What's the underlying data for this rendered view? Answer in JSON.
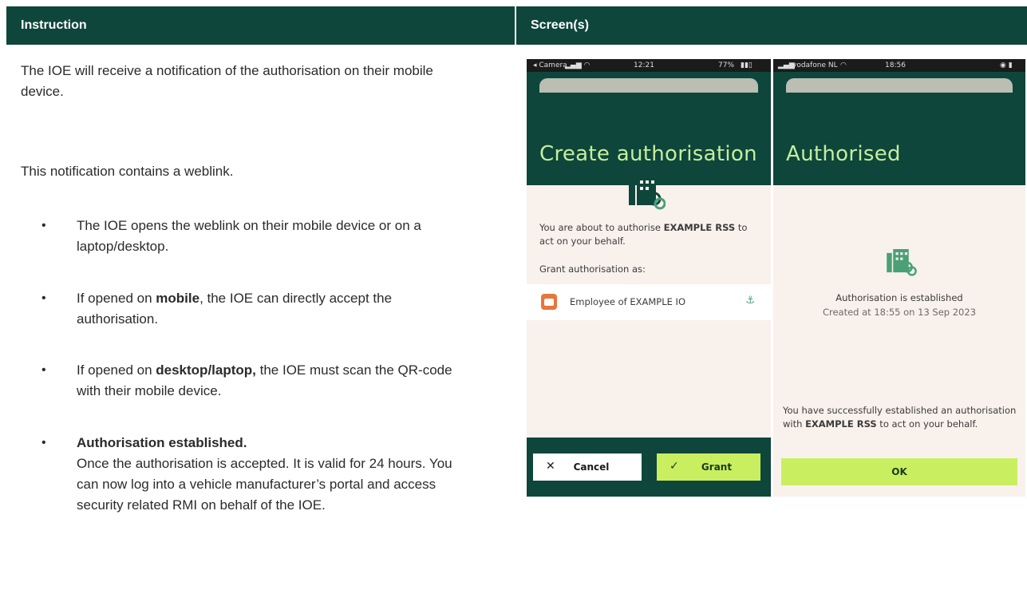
{
  "header": {
    "left": "Instruction",
    "right": "Screen(s)"
  },
  "instructions": {
    "p1": "The IOE will receive a notification of the authorisation on their mobile device.",
    "p2": "This notification contains a weblink.",
    "bullets": [
      {
        "pre": "The IOE opens the weblink on their mobile device or on a laptop/desktop.",
        "bold": "",
        "post": ""
      },
      {
        "pre": "If opened on ",
        "bold": "mobile",
        "post": ", the IOE can directly accept the authorisation."
      },
      {
        "pre": "If opened on ",
        "bold": "desktop/laptop,",
        "post": " the IOE must scan the QR-code with their mobile device."
      },
      {
        "pre": "",
        "bold": "Authorisation established.",
        "post": "Once the authorisation is accepted. It is valid for 24 hours. You can now log into a vehicle manufacturer’s portal and access security related RMI on behalf of the IOE."
      }
    ]
  },
  "phone1": {
    "status": {
      "carrier": "◂ Camera",
      "time": "12:21",
      "battery": "77%"
    },
    "title": "Create authorisation",
    "about_pre": "You are about to authorise ",
    "about_bold": "EXAMPLE RSS",
    "about_post": " to act on your behalf.",
    "grant_as": "Grant authorisation as:",
    "employee": "Employee of EXAMPLE IO",
    "cancel": "Cancel",
    "grant": "Grant"
  },
  "phone2": {
    "status": {
      "carrier": "vodafone NL",
      "time": "18:56"
    },
    "title": "Authorised",
    "established": "Authorisation is established",
    "created": "Created at 18:55 on 13 Sep 2023",
    "success_pre": "You have successfully established an authorisation with ",
    "success_bold": "EXAMPLE RSS",
    "success_post": " to act on your behalf.",
    "ok": "OK"
  },
  "colors": {
    "dark_green": "#0e463b",
    "lime": "#c9ef61",
    "title_green": "#c4ee9d",
    "cream": "#f9f1ec"
  }
}
